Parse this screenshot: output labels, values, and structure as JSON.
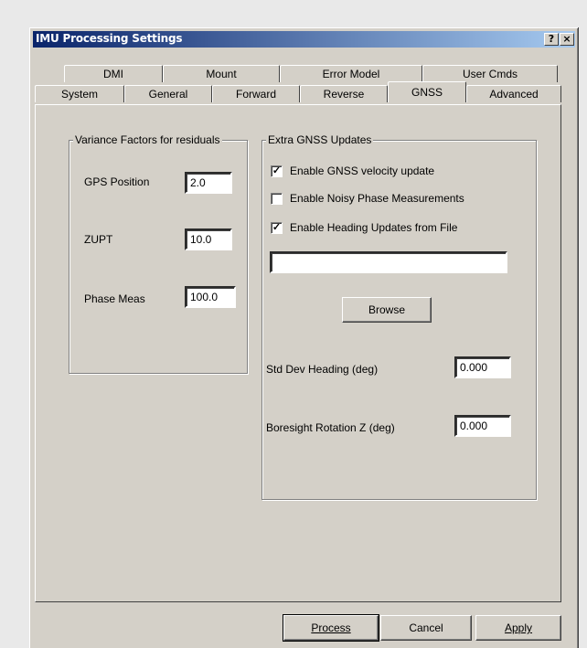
{
  "window": {
    "title": "IMU Processing Settings",
    "help_glyph": "?",
    "close_glyph": "×"
  },
  "tabs": {
    "row1": [
      "DMI",
      "Mount",
      "Error Model",
      "User Cmds"
    ],
    "row2": [
      "System",
      "General",
      "Forward",
      "Reverse",
      "GNSS",
      "Advanced"
    ],
    "active": "GNSS"
  },
  "variance_group": {
    "title": "Variance Factors for residuals",
    "gps_position_label": "GPS Position",
    "gps_position_value": "2.0",
    "zupt_label": "ZUPT",
    "zupt_value": "10.0",
    "phase_meas_label": "Phase Meas",
    "phase_meas_value": "100.0"
  },
  "gnss_group": {
    "title": "Extra GNSS  Updates",
    "velocity_update_label": "Enable GNSS velocity update",
    "velocity_update_checked": true,
    "noisy_phase_label": "Enable Noisy Phase Measurements",
    "noisy_phase_checked": false,
    "heading_updates_label": "Enable Heading Updates from File",
    "heading_updates_checked": true,
    "heading_file_value": "",
    "browse_label": "Browse",
    "std_dev_heading_label": "Std Dev Heading (deg)",
    "std_dev_heading_value": "0.000",
    "boresight_label": "Boresight Rotation Z (deg)",
    "boresight_value": "0.000"
  },
  "footer": {
    "process_label": "Process",
    "cancel_label": "Cancel",
    "apply_label": "Apply"
  }
}
